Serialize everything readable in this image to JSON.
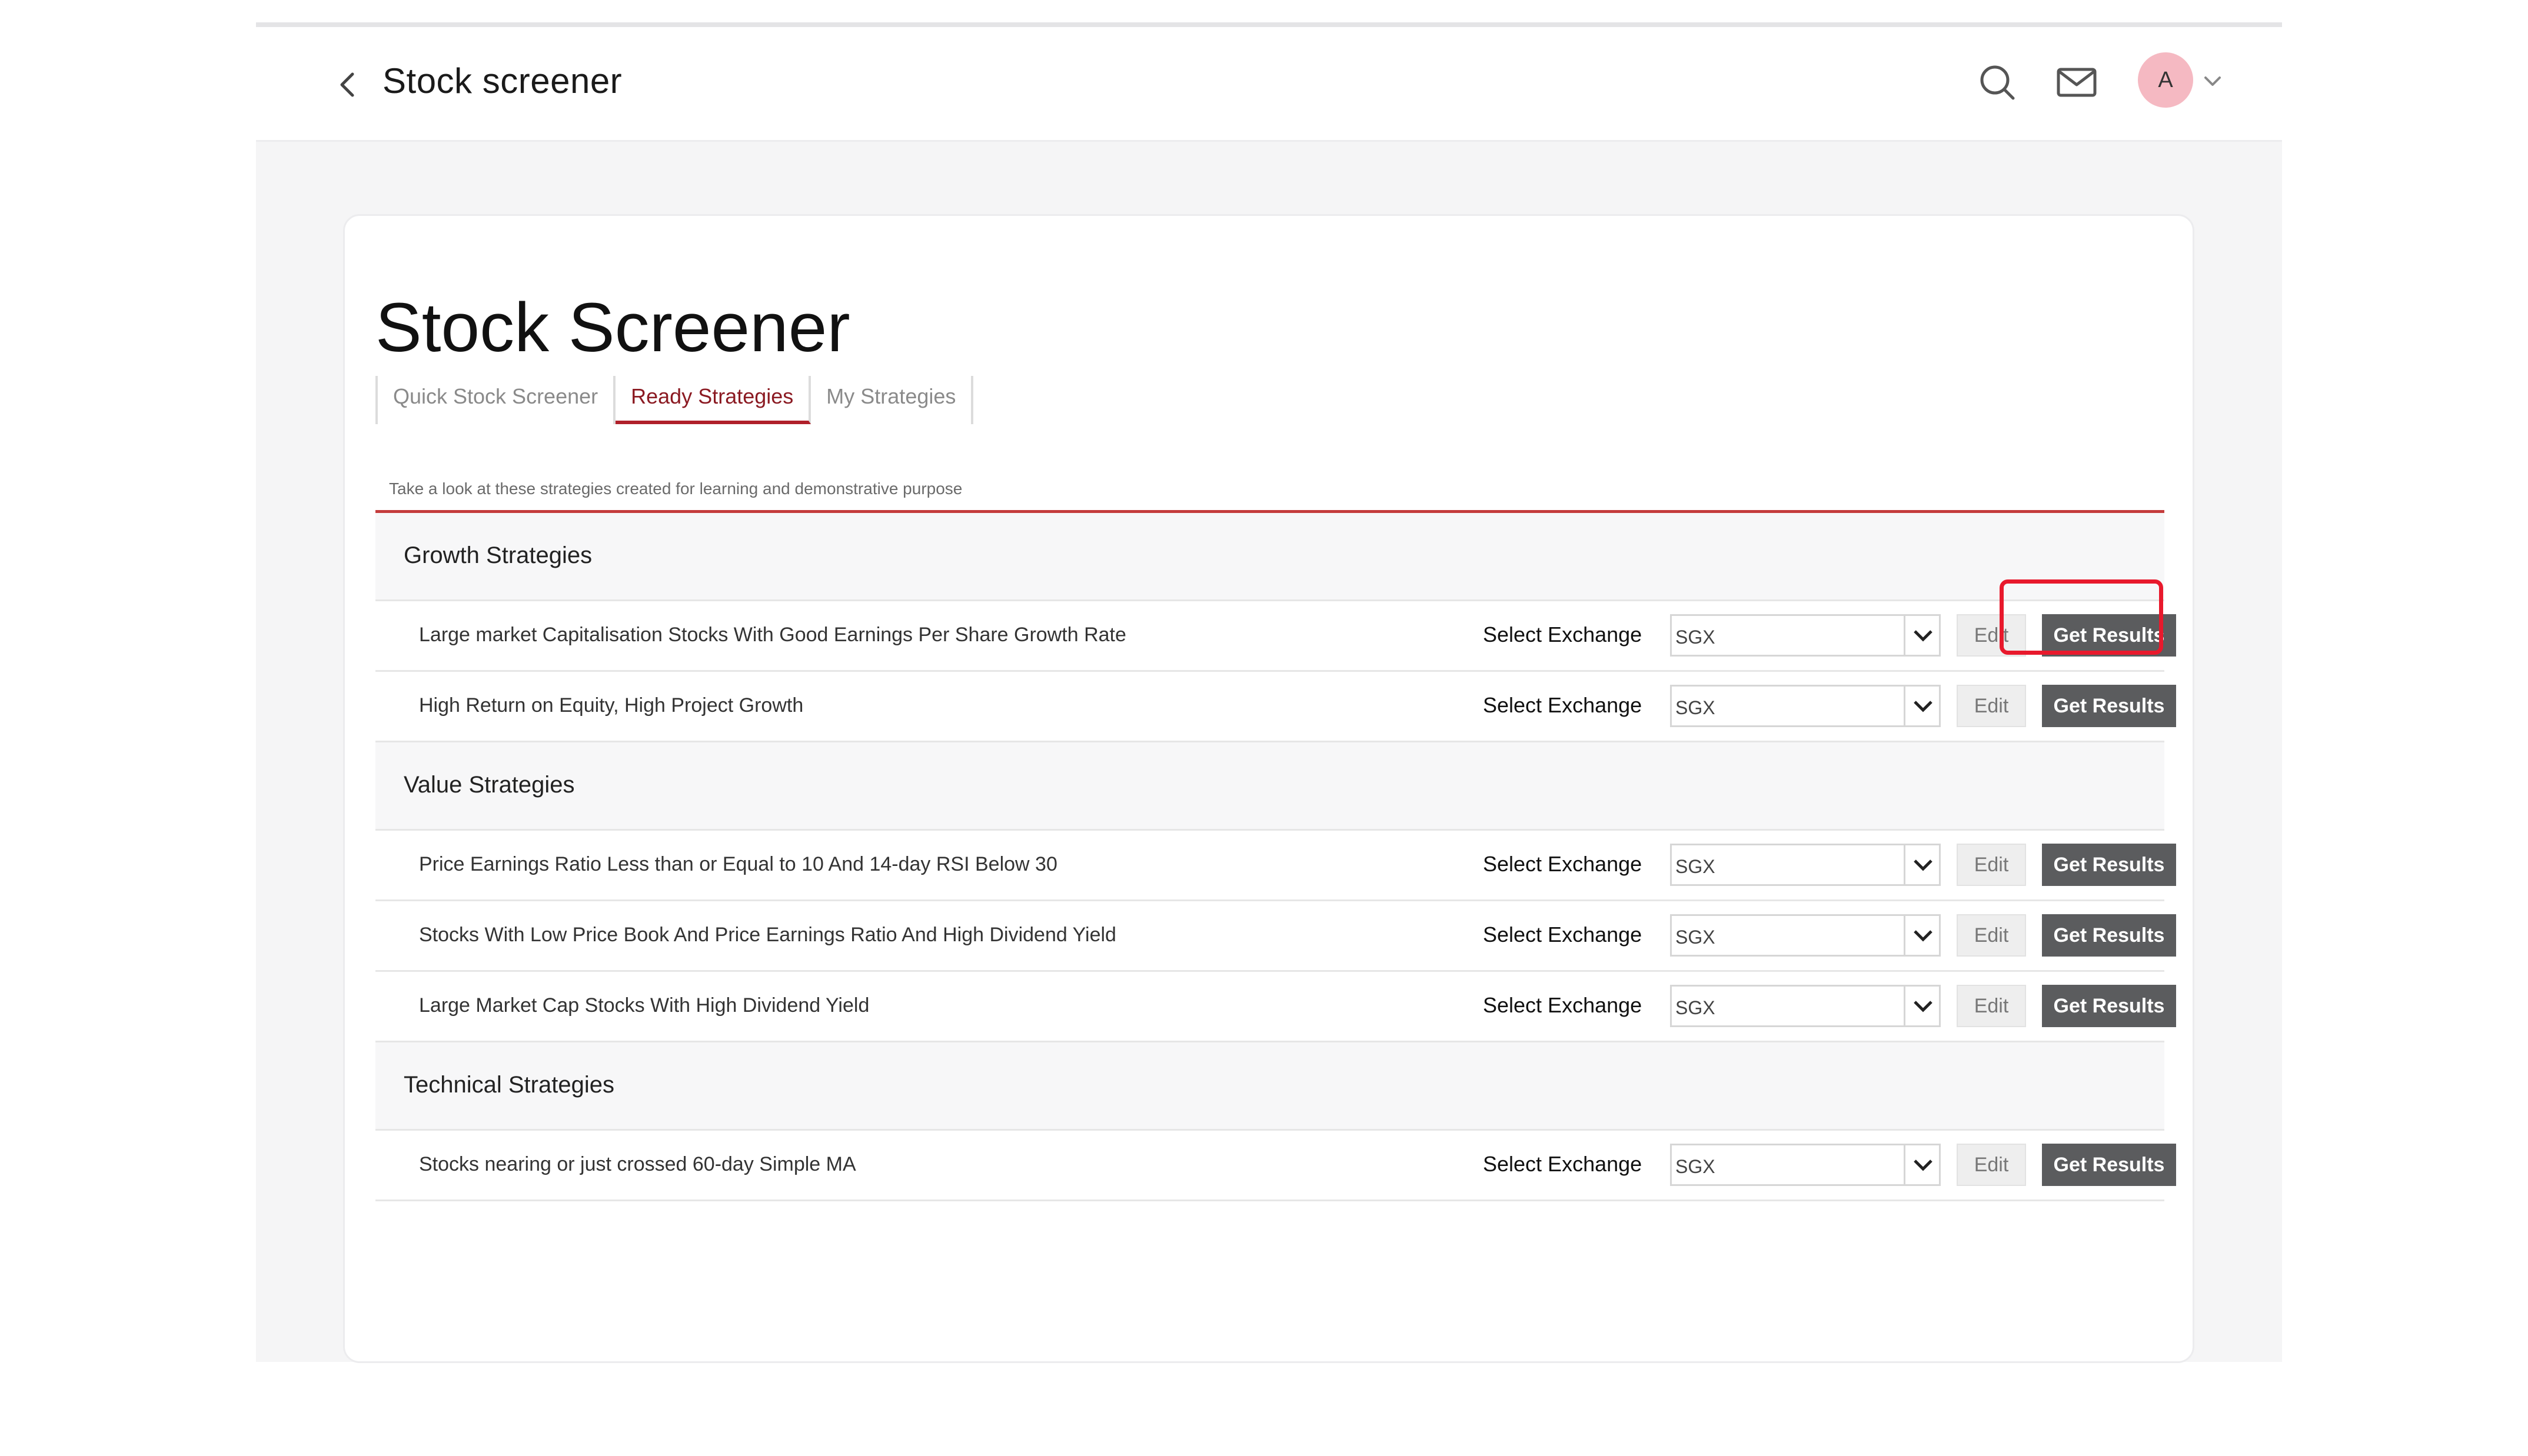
{
  "header": {
    "title": "Stock screener",
    "avatar_initial": "A"
  },
  "card": {
    "title": "Stock Screener",
    "tabs": [
      {
        "label": "Quick Stock Screener",
        "active": false
      },
      {
        "label": "Ready Strategies",
        "active": true
      },
      {
        "label": "My Strategies",
        "active": false
      }
    ],
    "description": "Take a look at these strategies created for learning and demonstrative purpose"
  },
  "row_labels": {
    "select_exchange": "Select Exchange",
    "edit": "Edit",
    "get_results": "Get Results"
  },
  "sections": [
    {
      "title": "Growth Strategies",
      "strategies": [
        {
          "name": "Large market Capitalisation Stocks With Good Earnings Per Share Growth Rate",
          "exchange": "SGX",
          "highlighted": true
        },
        {
          "name": "High Return on Equity, High Project Growth",
          "exchange": "SGX"
        }
      ]
    },
    {
      "title": "Value Strategies",
      "strategies": [
        {
          "name": "Price Earnings Ratio Less than or Equal to 10 And 14-day RSI Below 30",
          "exchange": "SGX"
        },
        {
          "name": "Stocks With Low Price Book And Price Earnings Ratio And High Dividend Yield",
          "exchange": "SGX"
        },
        {
          "name": "Large Market Cap Stocks With High Dividend Yield",
          "exchange": "SGX"
        }
      ]
    },
    {
      "title": "Technical Strategies",
      "strategies": [
        {
          "name": "Stocks nearing or just crossed 60-day Simple MA",
          "exchange": "SGX"
        }
      ]
    }
  ],
  "colors": {
    "accent": "#b0202a",
    "highlight_box": "#e8192c",
    "primary_button": "#5b5c5e",
    "avatar_bg": "#f5b9c2"
  }
}
